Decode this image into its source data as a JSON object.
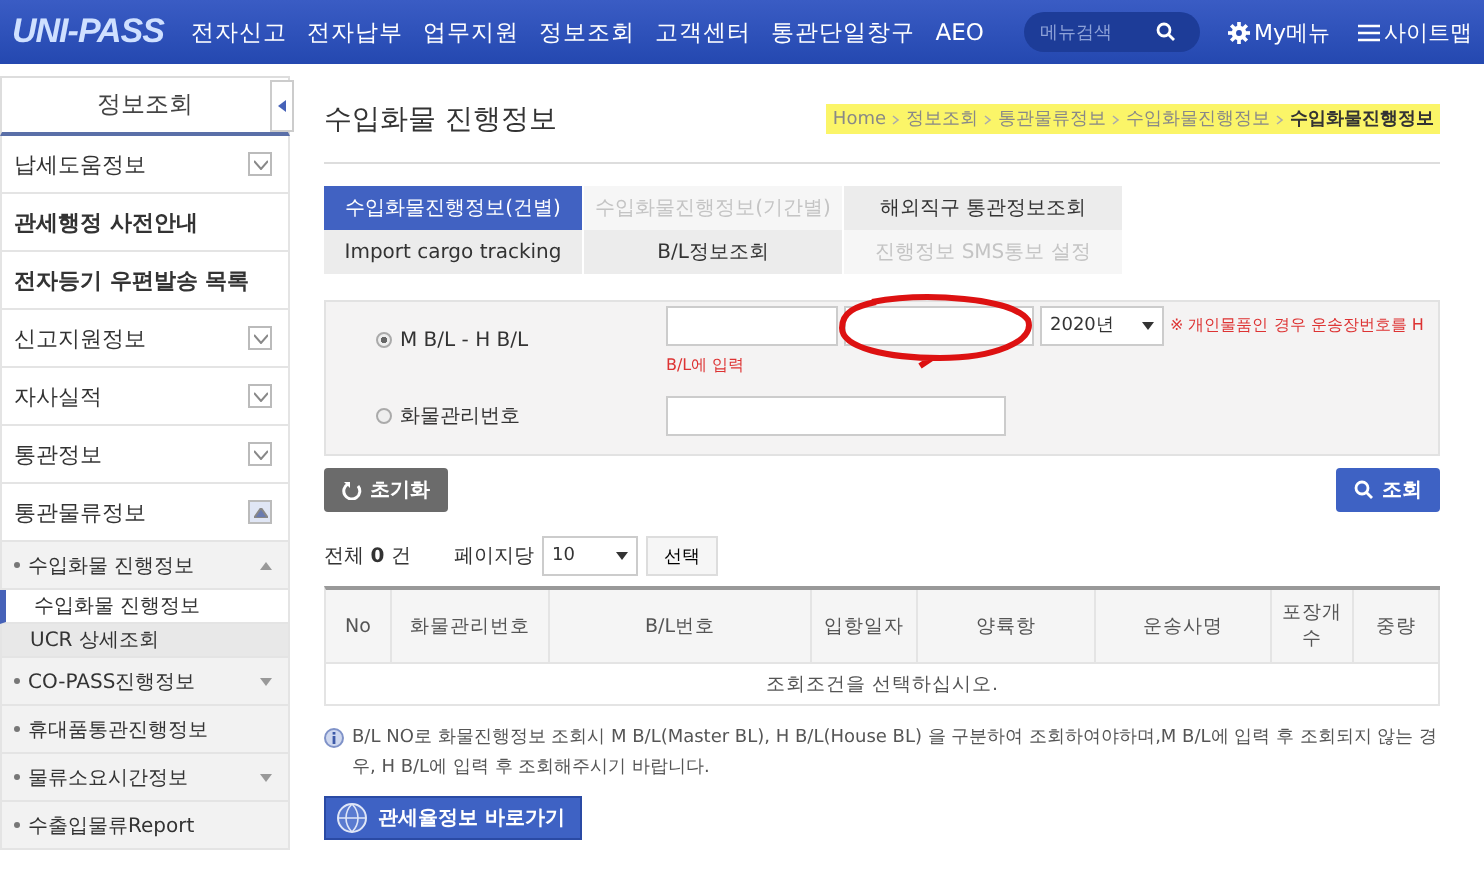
{
  "header": {
    "logo": "UNI-PASS",
    "menu": [
      "전자신고",
      "전자납부",
      "업무지원",
      "정보조회",
      "고객센터",
      "통관단일창구",
      "AEO"
    ],
    "search": {
      "placeholder": "메뉴검색"
    },
    "my_menu": "My메뉴",
    "sitemap": "사이트맵"
  },
  "sidebar": {
    "title": "정보조회",
    "items": [
      {
        "label": "납세도움정보",
        "expanded": false
      },
      {
        "label": "관세행정 사전안내"
      },
      {
        "label": "전자등기 우편발송 목록"
      },
      {
        "label": "신고지원정보",
        "expanded": false
      },
      {
        "label": "자사실적",
        "expanded": false
      },
      {
        "label": "통관정보",
        "expanded": false
      },
      {
        "label": "통관물류정보",
        "expanded": true,
        "children": [
          {
            "label": "수입화물 진행정보",
            "expanded": true,
            "children": [
              {
                "label": "수입화물 진행정보",
                "selected": true
              },
              {
                "label": "UCR 상세조회",
                "selected": false
              }
            ]
          },
          {
            "label": "CO-PASS진행정보",
            "expanded": false
          },
          {
            "label": "휴대품통관진행정보"
          },
          {
            "label": "물류소요시간정보",
            "expanded": false
          },
          {
            "label": "수출입물류Report"
          }
        ]
      }
    ]
  },
  "page": {
    "title": "수입화물 진행정보",
    "breadcrumb": {
      "highlighted": true,
      "items": [
        "Home",
        "정보조회",
        "통관물류정보",
        "수입화물진행정보",
        "수입화물진행정보"
      ]
    }
  },
  "tab_rows": [
    [
      {
        "label": "수입화물진행정보(건별)",
        "selected": true,
        "disabled": false
      },
      {
        "label": "수입화물진행정보(기간별)",
        "selected": false,
        "disabled": true
      },
      {
        "label": "해외직구 통관정보조회",
        "selected": false,
        "disabled": false
      }
    ],
    [
      {
        "label": "Import cargo tracking",
        "selected": false,
        "disabled": false
      },
      {
        "label": "B/L정보조회",
        "selected": false,
        "disabled": false
      },
      {
        "label": "진행정보 SMS통보 설정",
        "selected": false,
        "disabled": true
      }
    ]
  ],
  "form": {
    "options": [
      {
        "label": "M B/L - H B/L",
        "selected": true
      },
      {
        "label": "화물관리번호",
        "selected": false
      }
    ],
    "year": "2020년",
    "hint": "B/L에 입력",
    "notice": "※ 개인물품인 경우 운송장번호를 H",
    "annotation": {
      "kind": "circle"
    }
  },
  "buttons": {
    "reset": "초기화",
    "search": "조회"
  },
  "results": {
    "total": "전체 **0** 건",
    "per_page_label": "페이지당",
    "per_page": "10",
    "apply": "선택"
  },
  "table": {
    "columns": [
      "No",
      "화물관리번호",
      "B/L번호",
      "입항일자",
      "양륙항",
      "운송사명",
      "포장개수",
      "중량"
    ],
    "empty": "조회조건을 선택하십시오."
  },
  "info": "B/L NO로 화물진행정보 조회시 M B/L(Master BL), H B/L(House BL) 을 구분하여 조회하여야하며,M B/L에 입력 후 조회되지 않는 경우, H B/L에 입력 후 조회해주시기 바랍니다.",
  "link_button": "관세율정보 바로가기"
}
